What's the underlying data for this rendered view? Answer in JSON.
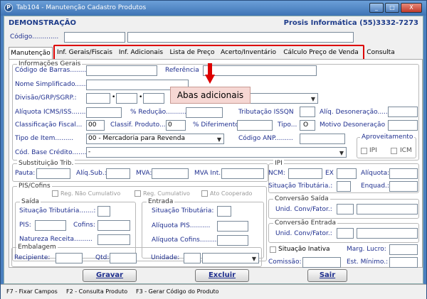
{
  "window": {
    "title": "Tab104 - Manutenção Cadastro Produtos",
    "app_icon": "P",
    "min": "_",
    "max": "□",
    "close": "X"
  },
  "header": {
    "left": "DEMONSTRAÇÃO",
    "right": "Prosis Informática (55)3332-7273"
  },
  "codigo_label": "Código.............",
  "tabs": [
    "Manutenção",
    "Inf. Gerais/Fiscais",
    "Inf. Adicionais",
    "Lista de Preço",
    "Acerto/Inventário",
    "Cálculo Preço de Venda",
    "Consulta"
  ],
  "callout": "Abas adicionais",
  "info_gerais": {
    "title": "Informações Gerais",
    "codigo_barras": "Código de Barras........",
    "referencia": "Referência",
    "nome_simplificado": "Nome Simplificado.......",
    "divisao": "Divisão/GRP/SGRP.:",
    "aliquota_icms": "Alíquota ICMS/ISS.......",
    "perc_reducao": "% Redução..........",
    "tributacao_issqn": "Tributação ISSQN",
    "aliq_desoneracao": "Alíq. Desoneração.......",
    "classificacao_fiscal": "Classificação Fiscal...",
    "classificacao_fiscal_value": "00",
    "classif_produto": "Classif. Produto...",
    "classif_produto_value": "0",
    "perc_diferimento": "% Diferimento",
    "tipo": "Tipo...",
    "tipo_value": "O",
    "motivo_desoneracao": "Motivo Desoneração",
    "tipo_item": "Tipo de Item.........",
    "tipo_item_value": "00 - Mercadoria para Revenda",
    "codigo_anp": "Código ANP.........",
    "cod_base_credito": "Cód. Base Crédito.......",
    "cod_base_credito_value": "-",
    "aproveitamento": "Aproveitamento",
    "ipi": "IPI",
    "icm": "ICM"
  },
  "subst": {
    "title": "Substituição Trib.",
    "pauta": "Pauta:",
    "aliq_sub": "Alíq.Sub.:",
    "mva": "MVA:",
    "mva_int": "MVA Int.:"
  },
  "ipi": {
    "title": "IPI",
    "ncm": "NCM:",
    "ex": "EX",
    "aliquota": "Alíquota:",
    "situacao": "Situação Tributária.:",
    "enquad": "Enquad.:"
  },
  "pis": {
    "title": "PIS/Cofins",
    "reg_nao_cumulativo": "Reg. Não Cumulativo",
    "reg_cumulativo": "Reg. Cumulativo",
    "ato_cooperado": "Ato Cooperado",
    "saida": "Saída",
    "saida_situacao": "Situação Tributária.......:",
    "saida_pis": "PIS:",
    "saida_cofins": "Cofins:",
    "natureza": "Natureza Receita.........",
    "entrada": "Entrada",
    "entrada_situacao": "Situação Tributária:",
    "aliquota_pis": "Alíquota PIS..........",
    "aliquota_cofins": "Alíquota Cofins.........."
  },
  "conv_saida": {
    "title": "Conversão Saída",
    "label": "Unid. Conv/Fator.:"
  },
  "conv_entrada": {
    "title": "Conversão Entrada",
    "label": "Unid. Conv/Fator.:"
  },
  "embalagem": {
    "title": "Embalagem",
    "recipiente": "Recipiente:",
    "qtd": "Qtd:",
    "unidade": "Unidade:"
  },
  "situacao_inativa": "Situação Inativa",
  "marg_lucro": "Marg. Lucro:",
  "comissao": "Comissão:",
  "est_minimo": "Est. Mínimo.:",
  "buttons": {
    "gravar": "Gravar",
    "excluir": "Excluir",
    "sair": "Sair"
  },
  "status": {
    "f7": "F7 - Fixar Campos",
    "f2": "F2 - Consulta Produto",
    "f3": "F3 - Gerar Código do Produto"
  }
}
